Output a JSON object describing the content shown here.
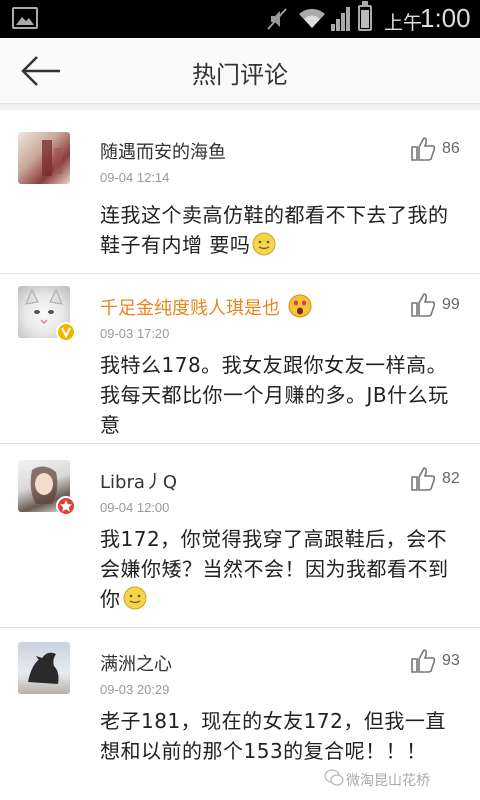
{
  "status_bar": {
    "ampm": "上午",
    "time": "1:00",
    "icons": [
      "gallery-icon",
      "mute-icon",
      "wifi-icon",
      "signal-icon",
      "battery-icon"
    ]
  },
  "header": {
    "title": "热门评论",
    "back_icon": "back-arrow-icon"
  },
  "comments": [
    {
      "name": "随遇而安的海鱼",
      "time": "09-04 12:14",
      "body": "连我这个卖高仿鞋的都看不下去了我的鞋子有内增 要吗",
      "likes": "86"
    },
    {
      "name": "千足金纯度贱人琪是也",
      "time": "09-03 17:20",
      "body": "我特么178。我女友跟你女友一样高。我每天都比你一个月赚的多。JB什么玩意",
      "likes": "99"
    },
    {
      "name": "Libra丿Q",
      "time": "09-04 12:00",
      "body": "我172，你觉得我穿了高跟鞋后，会不会嫌你矮？当然不会！因为我都看不到你",
      "likes": "82"
    },
    {
      "name": "满洲之心",
      "time": "09-03 20:29",
      "body": "老子181，现在的女友172，但我一直想和以前的那个153的复合呢！！！",
      "likes": "93"
    }
  ],
  "watermark": "微淘昆山花桥",
  "colors": {
    "status_bg": "#000000",
    "header_bg": "#fafafa",
    "vip_name": "#e8871e",
    "timestamp": "#999999",
    "divider": "#e4e4e4"
  }
}
